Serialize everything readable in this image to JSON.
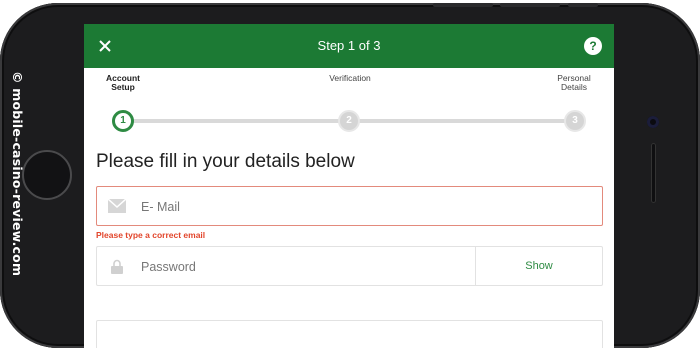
{
  "watermark": "© mobile-casino-review.com",
  "header": {
    "title": "Step 1 of 3",
    "close_icon": "close-icon",
    "help_icon": "help-icon",
    "help_glyph": "?",
    "background": "#1c7a34"
  },
  "steps": [
    {
      "label_line1": "Account",
      "label_line2": "Setup",
      "number": "1",
      "state": "active"
    },
    {
      "label_line1": "Verification",
      "label_line2": "",
      "number": "2",
      "state": "inactive"
    },
    {
      "label_line1": "Personal",
      "label_line2": "Details",
      "number": "3",
      "state": "inactive"
    }
  ],
  "form": {
    "heading": "Please fill in your details below",
    "email": {
      "placeholder": "E- Mail",
      "value": "",
      "icon": "mail-icon"
    },
    "email_error": "Please type a correct email",
    "password": {
      "placeholder": "Password",
      "value": "",
      "icon": "lock-icon",
      "toggle_label": "Show"
    }
  },
  "colors": {
    "accent": "#2e8b43",
    "error": "#e2452b",
    "error_border": "#e38a7c"
  }
}
